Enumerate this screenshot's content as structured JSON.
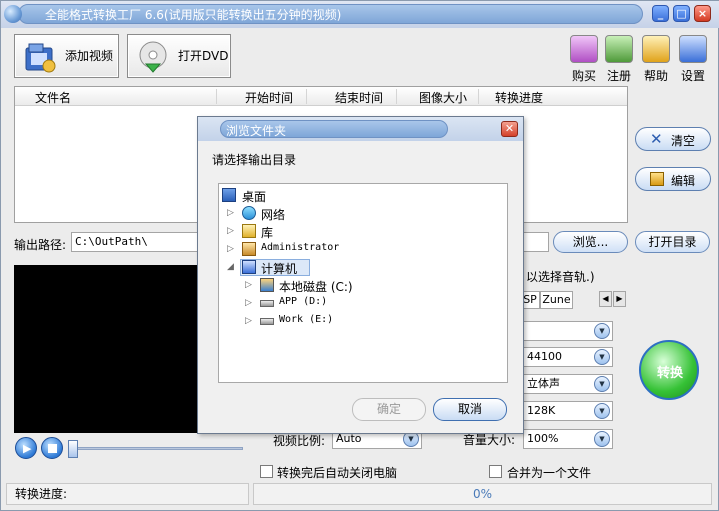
{
  "window": {
    "title": "全能格式转换工厂 6.6(试用版只能转换出五分钟的视频)",
    "caption_buttons": [
      "_",
      "□",
      "×"
    ]
  },
  "toolbar": {
    "add_video": "添加视频",
    "open_dvd": "打开DVD",
    "tools": [
      {
        "label": "购买",
        "icon": "cart-icon",
        "color": "#b04fc4"
      },
      {
        "label": "注册",
        "icon": "register-icon",
        "color": "#4f9a3a"
      },
      {
        "label": "帮助",
        "icon": "help-icon",
        "color": "#e0a21a"
      },
      {
        "label": "设置",
        "icon": "settings-icon",
        "color": "#3a6fd8"
      }
    ]
  },
  "file_list": {
    "columns": [
      "文件名",
      "开始时间",
      "结束时间",
      "图像大小",
      "转换进度"
    ]
  },
  "side_buttons": {
    "clear": "清空",
    "edit": "编辑"
  },
  "output": {
    "label": "输出路径:",
    "path": "C:\\OutPath\\",
    "browse": "浏览...",
    "open_dir": "打开目录"
  },
  "audio_hint": "以选择音轨.)",
  "tabs": {
    "visible": [
      "SP",
      "Zune"
    ]
  },
  "settings": {
    "sample_rate": "44100",
    "channels": "立体声",
    "bitrate": "128K",
    "volume_label": "音量大小:",
    "volume": "100%",
    "aspect_label": "视频比例:",
    "aspect": "Auto"
  },
  "convert_label": "转换",
  "options": {
    "shutdown": "转换完后自动关闭电脑",
    "merge": "合并为一个文件"
  },
  "status": {
    "label": "转换进度:",
    "percent": "0%"
  },
  "dialog": {
    "title": "浏览文件夹",
    "prompt": "请选择输出目录",
    "tree": {
      "desktop": "桌面",
      "network": "网络",
      "library": "库",
      "admin": "Administrator",
      "computer": "计算机",
      "drive_c": "本地磁盘 (C:)",
      "drive_d": "APP (D:)",
      "drive_e": "Work (E:)"
    },
    "ok": "确定",
    "cancel": "取消"
  }
}
